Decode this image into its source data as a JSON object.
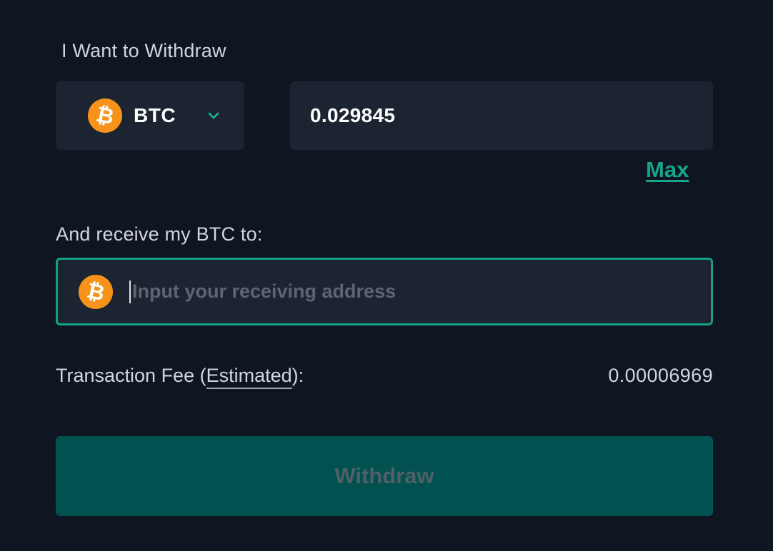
{
  "withdraw_section": {
    "label": "I Want to Withdraw",
    "asset": {
      "symbol": "BTC",
      "icon": "bitcoin-icon",
      "dropdown_icon": "chevron-down-icon"
    },
    "amount": {
      "value": "0.029845"
    },
    "max_label": "Max"
  },
  "receive_section": {
    "label": "And receive my BTC to:",
    "address": {
      "value": "",
      "placeholder": "Input your receiving address",
      "icon": "bitcoin-icon"
    }
  },
  "fee": {
    "label_prefix": "Transaction Fee (",
    "label_link": "Estimated",
    "label_suffix": "):",
    "value": "0.00006969"
  },
  "actions": {
    "withdraw_label": "Withdraw",
    "withdraw_enabled": false
  },
  "colors": {
    "background": "#0f1622",
    "panel": "#1b2430",
    "accent": "#16a085",
    "bitcoin": "#f7931a",
    "button_disabled": "#00514f"
  }
}
